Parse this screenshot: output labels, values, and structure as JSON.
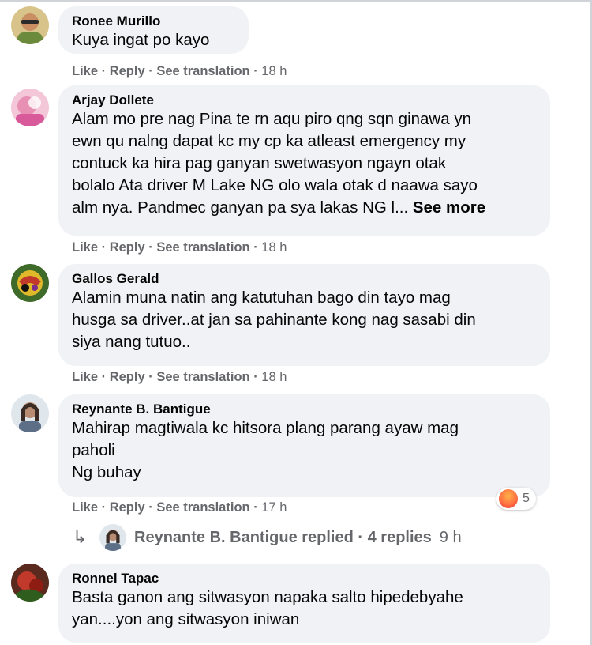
{
  "comments": [
    {
      "author": "Ronee Murillo",
      "lines": [
        "Kuya ingat po kayo"
      ],
      "actions": {
        "like": "Like",
        "reply": "Reply",
        "translate": "See translation",
        "time": "18 h"
      }
    },
    {
      "author": "Arjay Dollete",
      "lines": [
        "Alam mo pre nag Pina te rn aqu piro qng sqn ginawa yn",
        "ewn qu nalng dapat kc my cp ka atleast emergency my",
        "contuck ka hira pag ganyan swetwasyon ngayn otak",
        "bolalo Ata driver M Lake NG olo wala otak d naawa sayo",
        "alm nya. Pandmec ganyan pa sya lakas NG l..."
      ],
      "see_more": "See more",
      "actions": {
        "like": "Like",
        "reply": "Reply",
        "translate": "See translation",
        "time": "18 h"
      }
    },
    {
      "author": "Gallos Gerald",
      "lines": [
        "Alamin muna natin ang katutuhan bago din tayo mag",
        "husga sa driver..at jan sa pahinante kong nag sasabi din",
        "siya nang tutuo.."
      ],
      "actions": {
        "like": "Like",
        "reply": "Reply",
        "translate": "See translation",
        "time": "18 h"
      }
    },
    {
      "author": "Reynante B. Bantigue",
      "lines": [
        "Mahirap magtiwala kc hitsora plang parang ayaw mag",
        "paholi",
        "Ng buhay"
      ],
      "reaction_count": "5",
      "actions": {
        "like": "Like",
        "reply": "Reply",
        "translate": "See translation",
        "time": "17 h"
      }
    },
    {
      "author": "Ronnel Tapac",
      "lines": [
        "Basta ganon ang sitwasyon napaka salto hipedebyahe",
        "yan....yon ang sitwasyon iniwan"
      ]
    }
  ],
  "replies_row": {
    "arrow": "↳",
    "text": "Reynante B. Bantigue replied · 4 replies",
    "time": "9 h"
  },
  "icons": {
    "reaction": "angry-reaction-icon",
    "reply_arrow": "reply-arrow-icon"
  },
  "colors": {
    "bubble": "#f0f2f5",
    "meta_text": "#65676b",
    "text": "#050505"
  }
}
